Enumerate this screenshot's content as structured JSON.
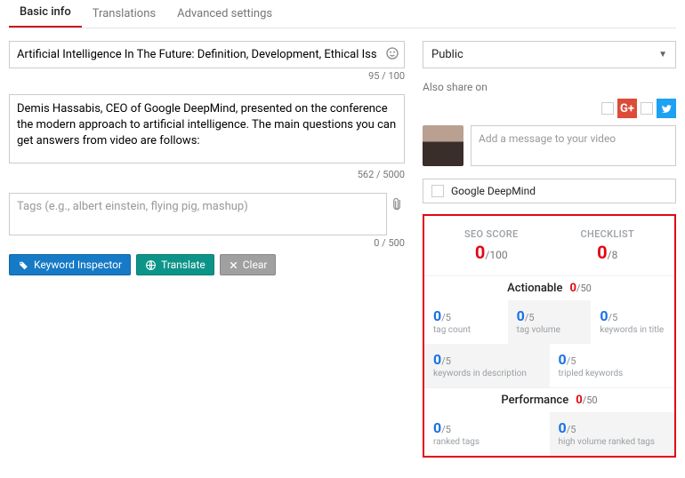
{
  "tabs": {
    "basic": "Basic info",
    "translations": "Translations",
    "advanced": "Advanced settings"
  },
  "title": {
    "value": "Artificial Intelligence In The Future: Definition, Development, Ethical Iss",
    "counter": "95 / 100"
  },
  "description": {
    "value": "Demis Hassabis, CEO of Google DeepMind, presented on the conference the modern approach to artificial intelligence. The main questions you can get answers from video are follows:",
    "counter": "562 / 5000"
  },
  "tags": {
    "placeholder": "Tags (e.g., albert einstein, flying pig, mashup)",
    "counter": "0 / 500"
  },
  "buttons": {
    "keyword": "Keyword Inspector",
    "translate": "Translate",
    "clear": "Clear"
  },
  "privacy": {
    "value": "Public"
  },
  "share": {
    "label": "Also share on",
    "msg_placeholder": "Add a message to your video"
  },
  "channel": {
    "name": "Google DeepMind"
  },
  "seo": {
    "score_label": "SEO SCORE",
    "score_val": "0",
    "score_den": "/100",
    "check_label": "CHECKLIST",
    "check_val": "0",
    "check_den": "/8",
    "actionable": {
      "label": "Actionable",
      "val": "0",
      "den": "/50"
    },
    "performance": {
      "label": "Performance",
      "val": "0",
      "den": "/50"
    },
    "cells": {
      "tag_count": {
        "val": "0",
        "den": "/5",
        "lbl": "tag count"
      },
      "tag_volume": {
        "val": "0",
        "den": "/5",
        "lbl": "tag volume"
      },
      "kw_title": {
        "val": "0",
        "den": "/5",
        "lbl": "keywords in title"
      },
      "kw_desc": {
        "val": "0",
        "den": "/5",
        "lbl": "keywords in description"
      },
      "tripled": {
        "val": "0",
        "den": "/5",
        "lbl": "tripled keywords"
      },
      "ranked": {
        "val": "0",
        "den": "/5",
        "lbl": "ranked tags"
      },
      "highvol": {
        "val": "0",
        "den": "/5",
        "lbl": "high volume ranked tags"
      }
    }
  }
}
